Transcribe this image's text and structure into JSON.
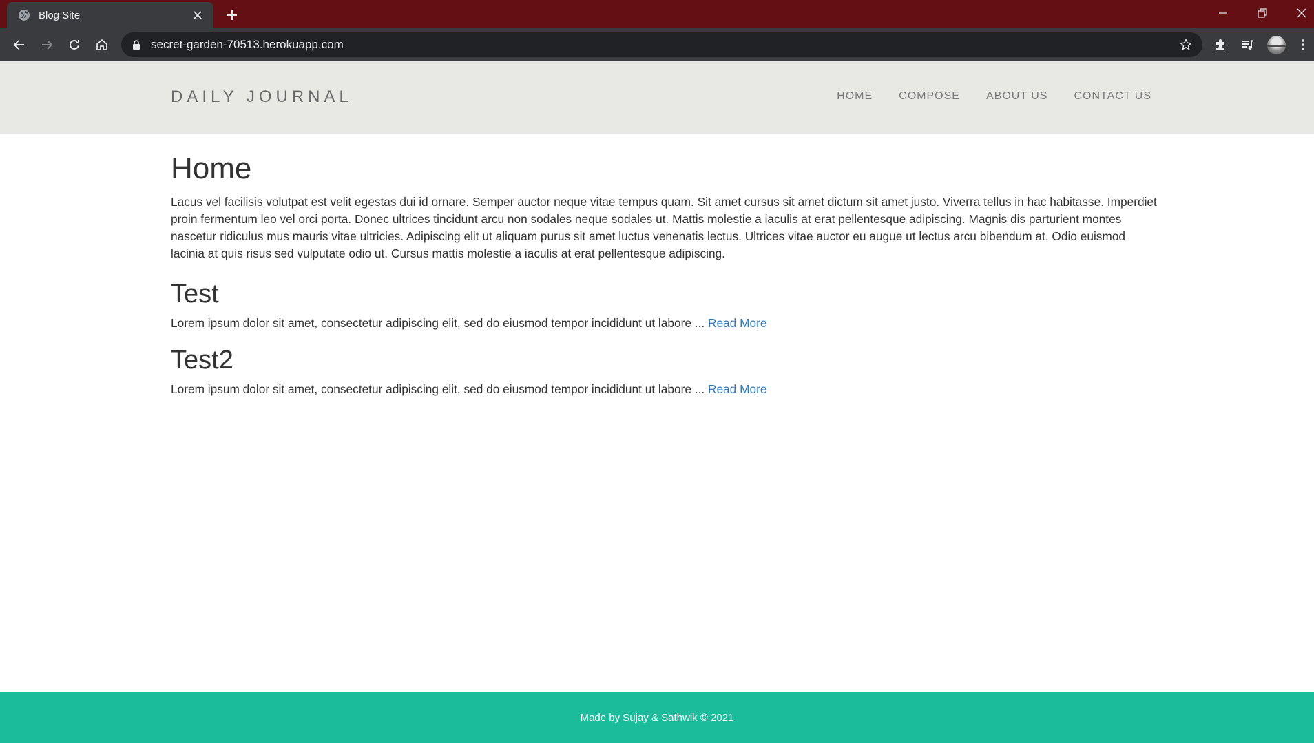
{
  "browser": {
    "tab_title": "Blog Site",
    "url": "secret-garden-70513.herokuapp.com"
  },
  "site": {
    "brand": "DAILY JOURNAL",
    "nav": [
      {
        "label": "HOME"
      },
      {
        "label": "COMPOSE"
      },
      {
        "label": "ABOUT US"
      },
      {
        "label": "CONTACT US"
      }
    ]
  },
  "home": {
    "title": "Home",
    "intro": "Lacus vel facilisis volutpat est velit egestas dui id ornare. Semper auctor neque vitae tempus quam. Sit amet cursus sit amet dictum sit amet justo. Viverra tellus in hac habitasse. Imperdiet proin fermentum leo vel orci porta. Donec ultrices tincidunt arcu non sodales neque sodales ut. Mattis molestie a iaculis at erat pellentesque adipiscing. Magnis dis parturient montes nascetur ridiculus mus mauris vitae ultricies. Adipiscing elit ut aliquam purus sit amet luctus venenatis lectus. Ultrices vitae auctor eu augue ut lectus arcu bibendum at. Odio euismod lacinia at quis risus sed vulputate odio ut. Cursus mattis molestie a iaculis at erat pellentesque adipiscing."
  },
  "posts": [
    {
      "title": "Test",
      "excerpt": "Lorem ipsum dolor sit amet, consectetur adipiscing elit, sed do eiusmod tempor incididunt ut labore ... ",
      "read_more": "Read More"
    },
    {
      "title": "Test2",
      "excerpt": "Lorem ipsum dolor sit amet, consectetur adipiscing elit, sed do eiusmod tempor incididunt ut labore ... ",
      "read_more": "Read More"
    }
  ],
  "footer": {
    "text": "Made by Sujay & Sathwik © 2021"
  },
  "colors": {
    "tabstrip": "#640f14",
    "header_bg": "#e8e9e5",
    "footer_bg": "#1abc9c",
    "link": "#337ab7"
  }
}
